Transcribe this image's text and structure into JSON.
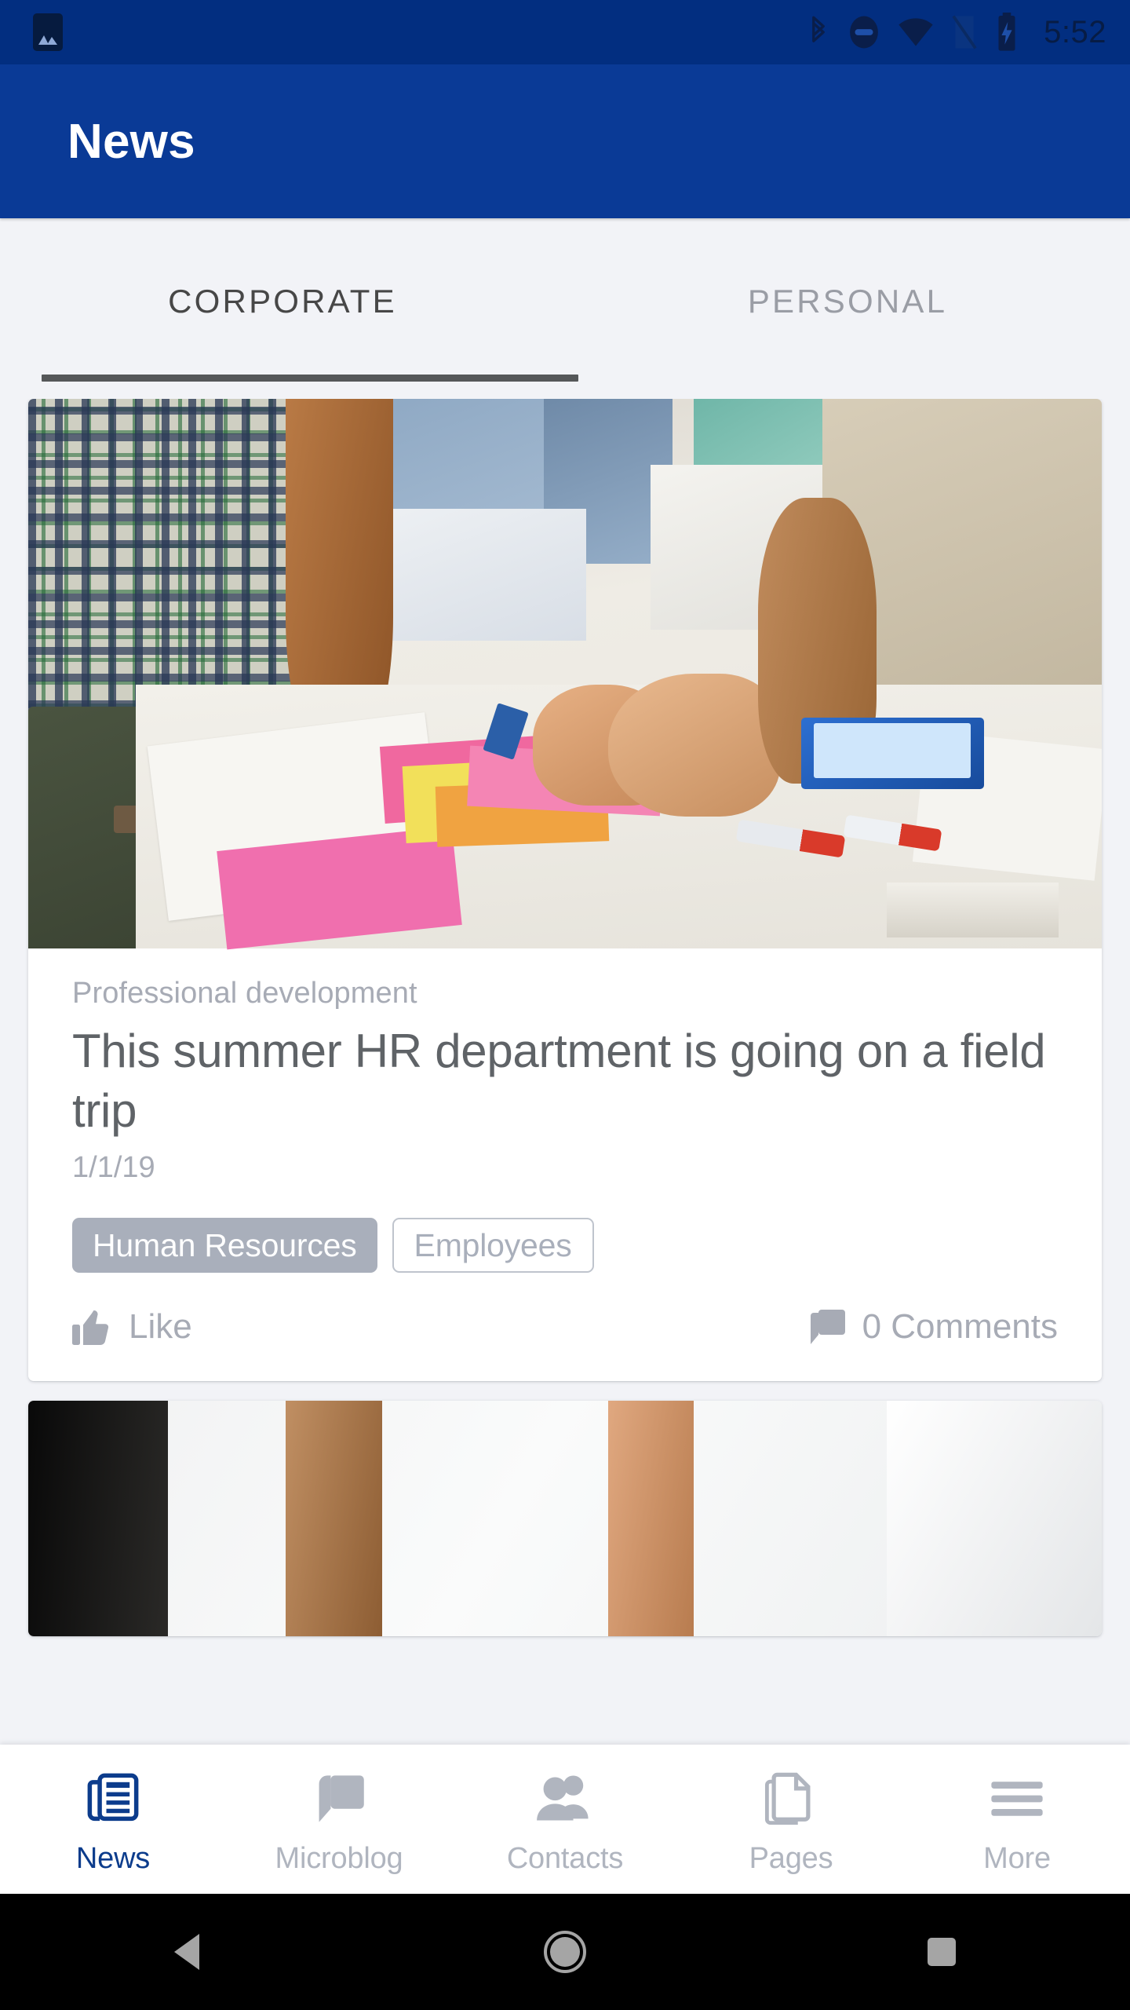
{
  "status_bar": {
    "time": "5:52",
    "icons": [
      {
        "name": "photo-notification-icon"
      },
      {
        "name": "bluetooth-icon"
      },
      {
        "name": "do-not-disturb-icon"
      },
      {
        "name": "wifi-icon"
      },
      {
        "name": "signal-off-icon"
      },
      {
        "name": "battery-charging-icon"
      }
    ]
  },
  "app_bar": {
    "title": "News",
    "background_color": "#0A3A96"
  },
  "tabs": {
    "items": [
      {
        "label": "CORPORATE",
        "active": true
      },
      {
        "label": "PERSONAL",
        "active": false
      }
    ]
  },
  "feed": {
    "cards": [
      {
        "kicker": "Professional development",
        "headline": "This summer HR department is going on a field trip",
        "date": "1/1/19",
        "chips": [
          {
            "label": "Human Resources",
            "style": "filled"
          },
          {
            "label": "Employees",
            "style": "outlined"
          }
        ],
        "like_label": "Like",
        "comments_label": "0 Comments"
      },
      {
        "kicker": "",
        "headline": "",
        "date": ""
      }
    ]
  },
  "bottom_nav": {
    "items": [
      {
        "label": "News",
        "icon": "newspaper-icon",
        "active": true
      },
      {
        "label": "Microblog",
        "icon": "chat-bubble-icon",
        "active": false
      },
      {
        "label": "Contacts",
        "icon": "people-icon",
        "active": false
      },
      {
        "label": "Pages",
        "icon": "document-icon",
        "active": false
      },
      {
        "label": "More",
        "icon": "hamburger-menu-icon",
        "active": false
      }
    ],
    "active_color": "#0C3C8C",
    "inactive_color": "#B0B5BF"
  },
  "android_nav": {
    "back": "back-button",
    "home": "home-button",
    "recents": "recents-button"
  },
  "colors": {
    "status_bar": "#022E80",
    "app_bar": "#0A3A96",
    "page_bg": "#F2F3F7",
    "card_bg": "#FFFFFF",
    "chip_filled": "#A9AFBB",
    "text_muted": "#A7ABB5",
    "headline": "#5F6367",
    "tab_active": "#474747",
    "tab_inactive": "#9A9DA5"
  }
}
